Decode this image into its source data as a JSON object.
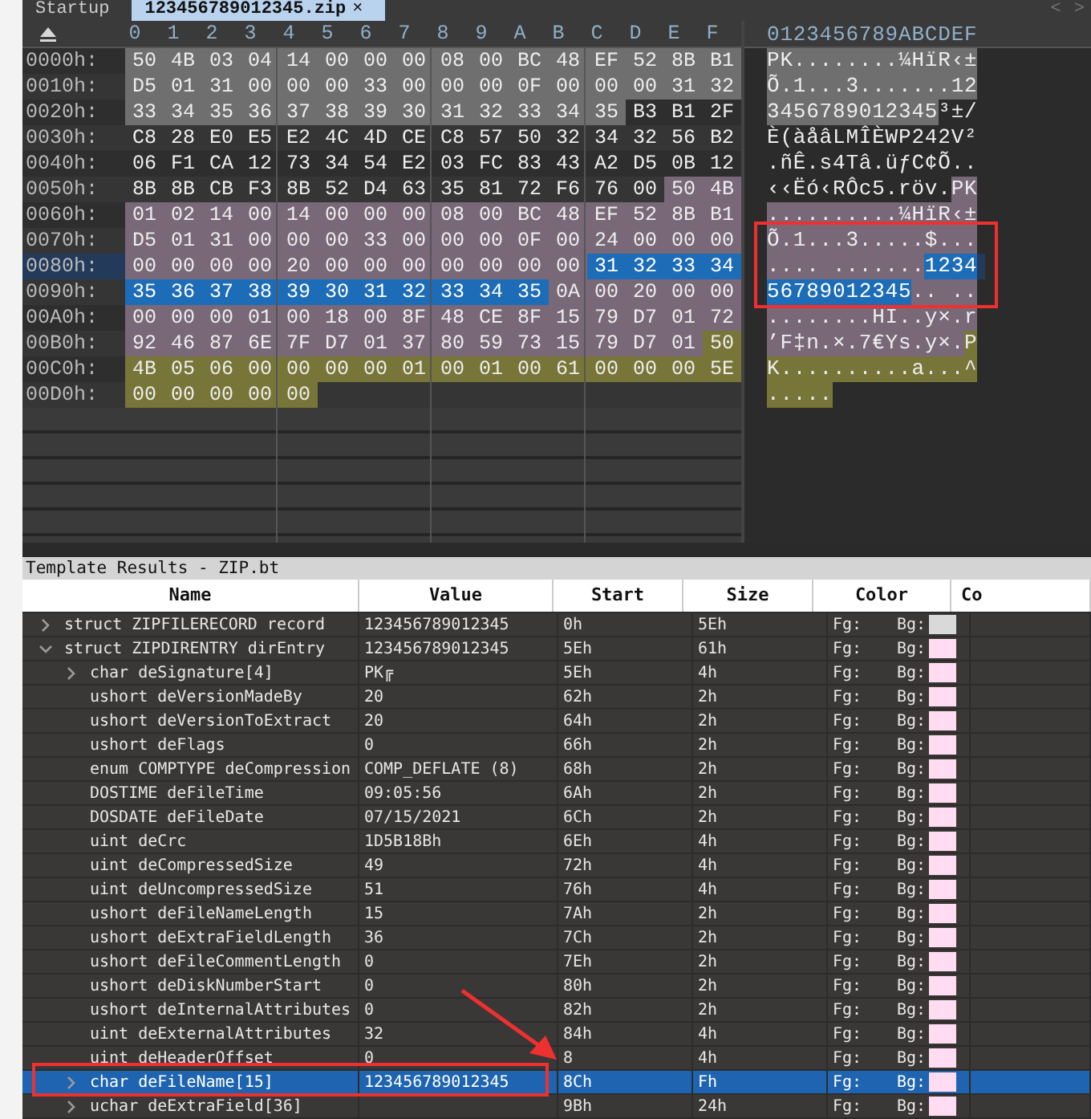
{
  "tabs": [
    {
      "label": "Startup",
      "selected": false
    },
    {
      "label": "123456789012345.zip",
      "close": "×",
      "selected": true
    }
  ],
  "nav": [
    "<",
    ">"
  ],
  "hex_view": {
    "columns": [
      "0",
      "1",
      "2",
      "3",
      "4",
      "5",
      "6",
      "7",
      "8",
      "9",
      "A",
      "B",
      "C",
      "D",
      "E",
      "F"
    ],
    "ascii_header": "0123456789ABCDEF",
    "rows": [
      {
        "offset": "0000h:",
        "current": false,
        "segments": [
          {
            "kind": "record",
            "bytes": [
              "50",
              "4B",
              "03",
              "04",
              "14",
              "00",
              "00",
              "00",
              "08",
              "00",
              "BC",
              "48",
              "EF",
              "52",
              "8B",
              "B1"
            ]
          }
        ],
        "ascii": [
          {
            "kind": "record",
            "text": "PK........¼HïR‹±"
          }
        ]
      },
      {
        "offset": "0010h:",
        "current": false,
        "segments": [
          {
            "kind": "record",
            "bytes": [
              "D5",
              "01",
              "31",
              "00",
              "00",
              "00",
              "33",
              "00",
              "00",
              "00",
              "0F",
              "00",
              "00",
              "00",
              "31",
              "32"
            ]
          }
        ],
        "ascii": [
          {
            "kind": "record",
            "text": "Õ.1...3.......12"
          }
        ]
      },
      {
        "offset": "0020h:",
        "current": false,
        "segments": [
          {
            "kind": "record",
            "bytes": [
              "33",
              "34",
              "35",
              "36",
              "37",
              "38",
              "39",
              "30",
              "31",
              "32",
              "33",
              "34",
              "35"
            ]
          },
          {
            "kind": "plain",
            "bytes": [
              "B3",
              "B1",
              "2F"
            ]
          }
        ],
        "ascii": [
          {
            "kind": "record",
            "text": "3456789012345"
          },
          {
            "kind": "plain",
            "text": "³±/"
          }
        ]
      },
      {
        "offset": "0030h:",
        "current": false,
        "segments": [
          {
            "kind": "plain",
            "bytes": [
              "C8",
              "28",
              "E0",
              "E5",
              "E2",
              "4C",
              "4D",
              "CE",
              "C8",
              "57",
              "50",
              "32",
              "34",
              "32",
              "56",
              "B2"
            ]
          }
        ],
        "ascii": [
          {
            "kind": "plain",
            "text": "È(àåâLMÎÈWP242V²"
          }
        ]
      },
      {
        "offset": "0040h:",
        "current": false,
        "segments": [
          {
            "kind": "plain",
            "bytes": [
              "06",
              "F1",
              "CA",
              "12",
              "73",
              "34",
              "54",
              "E2",
              "03",
              "FC",
              "83",
              "43",
              "A2",
              "D5",
              "0B",
              "12"
            ]
          }
        ],
        "ascii": [
          {
            "kind": "plain",
            "text": ".ñÊ.s4Tâ.üƒC¢Õ.."
          }
        ]
      },
      {
        "offset": "0050h:",
        "current": false,
        "segments": [
          {
            "kind": "plain",
            "bytes": [
              "8B",
              "8B",
              "CB",
              "F3",
              "8B",
              "52",
              "D4",
              "63",
              "35",
              "81",
              "72",
              "F6",
              "76",
              "00"
            ]
          },
          {
            "kind": "dir",
            "bytes": [
              "50",
              "4B"
            ]
          }
        ],
        "ascii": [
          {
            "kind": "plain",
            "text": "‹‹Ëó‹RÔc5.röv."
          },
          {
            "kind": "dir",
            "text": "PK"
          }
        ]
      },
      {
        "offset": "0060h:",
        "current": false,
        "segments": [
          {
            "kind": "dir",
            "bytes": [
              "01",
              "02",
              "14",
              "00",
              "14",
              "00",
              "00",
              "00",
              "08",
              "00",
              "BC",
              "48",
              "EF",
              "52",
              "8B",
              "B1"
            ]
          }
        ],
        "ascii": [
          {
            "kind": "dir",
            "text": "..........¼HïR‹±"
          }
        ]
      },
      {
        "offset": "0070h:",
        "current": false,
        "segments": [
          {
            "kind": "dir",
            "bytes": [
              "D5",
              "01",
              "31",
              "00",
              "00",
              "00",
              "33",
              "00",
              "00",
              "00",
              "0F",
              "00",
              "24",
              "00",
              "00",
              "00"
            ]
          }
        ],
        "ascii": [
          {
            "kind": "dir",
            "text": "Õ.1...3.....$..."
          }
        ]
      },
      {
        "offset": "0080h:",
        "current": true,
        "segments": [
          {
            "kind": "dir",
            "bytes": [
              "00",
              "00",
              "00",
              "00",
              "20",
              "00",
              "00",
              "00",
              "00",
              "00",
              "00",
              "00"
            ]
          },
          {
            "kind": "selected",
            "bytes": [
              "31",
              "32",
              "33",
              "34"
            ]
          }
        ],
        "ascii": [
          {
            "kind": "dir",
            "text": ".... ......."
          },
          {
            "kind": "selected",
            "text": "1234"
          }
        ]
      },
      {
        "offset": "0090h:",
        "current": false,
        "segments": [
          {
            "kind": "selected",
            "bytes": [
              "35",
              "36",
              "37",
              "38",
              "39",
              "30",
              "31",
              "32",
              "33",
              "34",
              "35"
            ]
          },
          {
            "kind": "dir",
            "bytes": [
              "0A",
              "00",
              "20",
              "00",
              "00"
            ]
          }
        ],
        "ascii": [
          {
            "kind": "selected",
            "text": "56789012345"
          },
          {
            "kind": "dir",
            "text": ".. .."
          }
        ]
      },
      {
        "offset": "00A0h:",
        "current": false,
        "segments": [
          {
            "kind": "dir",
            "bytes": [
              "00",
              "00",
              "00",
              "01",
              "00",
              "18",
              "00",
              "8F",
              "48",
              "CE",
              "8F",
              "15",
              "79",
              "D7",
              "01",
              "72"
            ]
          }
        ],
        "ascii": [
          {
            "kind": "dir",
            "text": "........HÏ..y×.r"
          }
        ]
      },
      {
        "offset": "00B0h:",
        "current": false,
        "segments": [
          {
            "kind": "dir",
            "bytes": [
              "92",
              "46",
              "87",
              "6E",
              "7F",
              "D7",
              "01",
              "37",
              "80",
              "59",
              "73",
              "15",
              "79",
              "D7",
              "01"
            ]
          },
          {
            "kind": "end",
            "bytes": [
              "50"
            ]
          }
        ],
        "ascii": [
          {
            "kind": "dir",
            "text": "’F‡n.×.7€Ys.y×."
          },
          {
            "kind": "end",
            "text": "P"
          }
        ]
      },
      {
        "offset": "00C0h:",
        "current": false,
        "segments": [
          {
            "kind": "end",
            "bytes": [
              "4B",
              "05",
              "06",
              "00",
              "00",
              "00",
              "00",
              "01",
              "00",
              "01",
              "00",
              "61",
              "00",
              "00",
              "00",
              "5E"
            ]
          }
        ],
        "ascii": [
          {
            "kind": "end",
            "text": "K..........a...^"
          }
        ]
      },
      {
        "offset": "00D0h:",
        "current": false,
        "segments": [
          {
            "kind": "end",
            "bytes": [
              "00",
              "00",
              "00",
              "00",
              "00"
            ]
          }
        ],
        "ascii": [
          {
            "kind": "end",
            "text": "....."
          }
        ]
      }
    ]
  },
  "template": {
    "title": "Template Results - ZIP.bt",
    "columns": [
      "Name",
      "Value",
      "Start",
      "Size",
      "Color",
      "Co"
    ],
    "rows": [
      {
        "name": "struct ZIPFILERECORD record",
        "value": "123456789012345",
        "start": "0h",
        "size": "5Eh",
        "fg": "Fg:",
        "bg": "Bg:",
        "color": "#d9d9d9",
        "expanded": false,
        "selected": false
      },
      {
        "name": "struct ZIPDIRENTRY dirEntry",
        "value": "123456789012345",
        "start": "5Eh",
        "size": "61h",
        "fg": "Fg:",
        "bg": "Bg:",
        "color": "#ffdcf2",
        "expanded": true,
        "selected": false,
        "children": [
          {
            "name": "char deSignature[4]",
            "value": "PK╔",
            "start": "5Eh",
            "size": "4h",
            "fg": "Fg:",
            "bg": "Bg:",
            "color": "#ffdcf2",
            "expanded": false,
            "selected": false
          },
          {
            "name": "ushort deVersionMadeBy",
            "value": "20",
            "start": "62h",
            "size": "2h",
            "fg": "Fg:",
            "bg": "Bg:",
            "color": "#ffdcf2",
            "selected": false
          },
          {
            "name": "ushort deVersionToExtract",
            "value": "20",
            "start": "64h",
            "size": "2h",
            "fg": "Fg:",
            "bg": "Bg:",
            "color": "#ffdcf2",
            "selected": false
          },
          {
            "name": "ushort deFlags",
            "value": "0",
            "start": "66h",
            "size": "2h",
            "fg": "Fg:",
            "bg": "Bg:",
            "color": "#ffdcf2",
            "selected": false
          },
          {
            "name": "enum COMPTYPE deCompression",
            "value": "COMP_DEFLATE (8)",
            "start": "68h",
            "size": "2h",
            "fg": "Fg:",
            "bg": "Bg:",
            "color": "#ffdcf2",
            "selected": false
          },
          {
            "name": "DOSTIME deFileTime",
            "value": "09:05:56",
            "start": "6Ah",
            "size": "2h",
            "fg": "Fg:",
            "bg": "Bg:",
            "color": "#ffdcf2",
            "selected": false
          },
          {
            "name": "DOSDATE deFileDate",
            "value": "07/15/2021",
            "start": "6Ch",
            "size": "2h",
            "fg": "Fg:",
            "bg": "Bg:",
            "color": "#ffdcf2",
            "selected": false
          },
          {
            "name": "uint deCrc",
            "value": "1D5B18Bh",
            "start": "6Eh",
            "size": "4h",
            "fg": "Fg:",
            "bg": "Bg:",
            "color": "#ffdcf2",
            "selected": false
          },
          {
            "name": "uint deCompressedSize",
            "value": "49",
            "start": "72h",
            "size": "4h",
            "fg": "Fg:",
            "bg": "Bg:",
            "color": "#ffdcf2",
            "selected": false
          },
          {
            "name": "uint deUncompressedSize",
            "value": "51",
            "start": "76h",
            "size": "4h",
            "fg": "Fg:",
            "bg": "Bg:",
            "color": "#ffdcf2",
            "selected": false
          },
          {
            "name": "ushort deFileNameLength",
            "value": "15",
            "start": "7Ah",
            "size": "2h",
            "fg": "Fg:",
            "bg": "Bg:",
            "color": "#ffdcf2",
            "selected": false
          },
          {
            "name": "ushort deExtraFieldLength",
            "value": "36",
            "start": "7Ch",
            "size": "2h",
            "fg": "Fg:",
            "bg": "Bg:",
            "color": "#ffdcf2",
            "selected": false
          },
          {
            "name": "ushort deFileCommentLength",
            "value": "0",
            "start": "7Eh",
            "size": "2h",
            "fg": "Fg:",
            "bg": "Bg:",
            "color": "#ffdcf2",
            "selected": false
          },
          {
            "name": "ushort deDiskNumberStart",
            "value": "0",
            "start": "80h",
            "size": "2h",
            "fg": "Fg:",
            "bg": "Bg:",
            "color": "#ffdcf2",
            "selected": false
          },
          {
            "name": "ushort deInternalAttributes",
            "value": "0",
            "start": "82h",
            "size": "2h",
            "fg": "Fg:",
            "bg": "Bg:",
            "color": "#ffdcf2",
            "selected": false
          },
          {
            "name": "uint deExternalAttributes",
            "value": "32",
            "start": "84h",
            "size": "4h",
            "fg": "Fg:",
            "bg": "Bg:",
            "color": "#ffdcf2",
            "selected": false
          },
          {
            "name": "uint deHeaderOffset",
            "value": "0",
            "start": "8",
            "size": "4h",
            "fg": "Fg:",
            "bg": "Bg:",
            "color": "#ffdcf2",
            "selected": false
          },
          {
            "name": "char deFileName[15]",
            "value": "123456789012345",
            "start": "8Ch",
            "size": "Fh",
            "fg": "Fg:",
            "bg": "Bg:",
            "color": "#ffdcf2",
            "expanded": false,
            "selected": true
          },
          {
            "name": "uchar deExtraField[36]",
            "start": "9Bh",
            "size": "24h",
            "fg": "Fg:",
            "bg": "Bg:",
            "color": "#ffdcf2",
            "expanded": false,
            "selected": false
          }
        ]
      }
    ]
  }
}
